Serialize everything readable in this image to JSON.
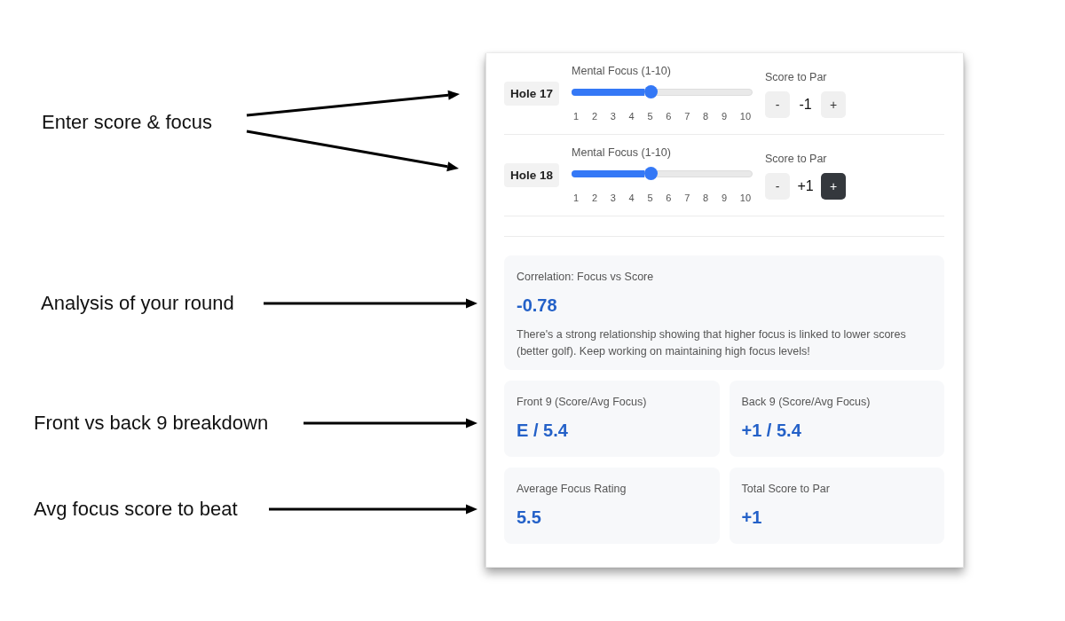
{
  "annotations": [
    {
      "text": "Enter score & focus",
      "kind": "split"
    },
    {
      "text": "Analysis of your round",
      "kind": "single"
    },
    {
      "text": "Front vs back 9 breakdown",
      "kind": "single"
    },
    {
      "text": "Avg focus score to beat",
      "kind": "single"
    }
  ],
  "holes": [
    {
      "label": "Hole 17",
      "focus": {
        "label": "Mental Focus (1-10)",
        "level": 0.44,
        "ticks": [
          "1",
          "2",
          "3",
          "4",
          "5",
          "6",
          "7",
          "8",
          "9",
          "10"
        ]
      },
      "score": {
        "label": "Score to Par",
        "value": "-1",
        "decrement": {
          "label": "-",
          "active": false
        },
        "increment": {
          "label": "+",
          "active": false
        }
      }
    },
    {
      "label": "Hole 18",
      "focus": {
        "label": "Mental Focus (1-10)",
        "level": 0.44,
        "ticks": [
          "1",
          "2",
          "3",
          "4",
          "5",
          "6",
          "7",
          "8",
          "9",
          "10"
        ]
      },
      "score": {
        "label": "Score to Par",
        "value": "+1",
        "decrement": {
          "label": "-",
          "active": false
        },
        "increment": {
          "label": "+",
          "active": true
        }
      }
    }
  ],
  "correlation": {
    "title": "Correlation: Focus vs Score",
    "value": "-0.78",
    "description": "There's a strong relationship showing that higher focus is linked to lower scores (better golf). Keep working on maintaining high focus levels!"
  },
  "stats": [
    {
      "label": "Front 9 (Score/Avg Focus)",
      "value": "E / 5.4"
    },
    {
      "label": "Back 9 (Score/Avg Focus)",
      "value": "+1 / 5.4"
    },
    {
      "label": "Average Focus Rating",
      "value": "5.5"
    },
    {
      "label": "Total Score to Par",
      "value": "+1"
    }
  ]
}
